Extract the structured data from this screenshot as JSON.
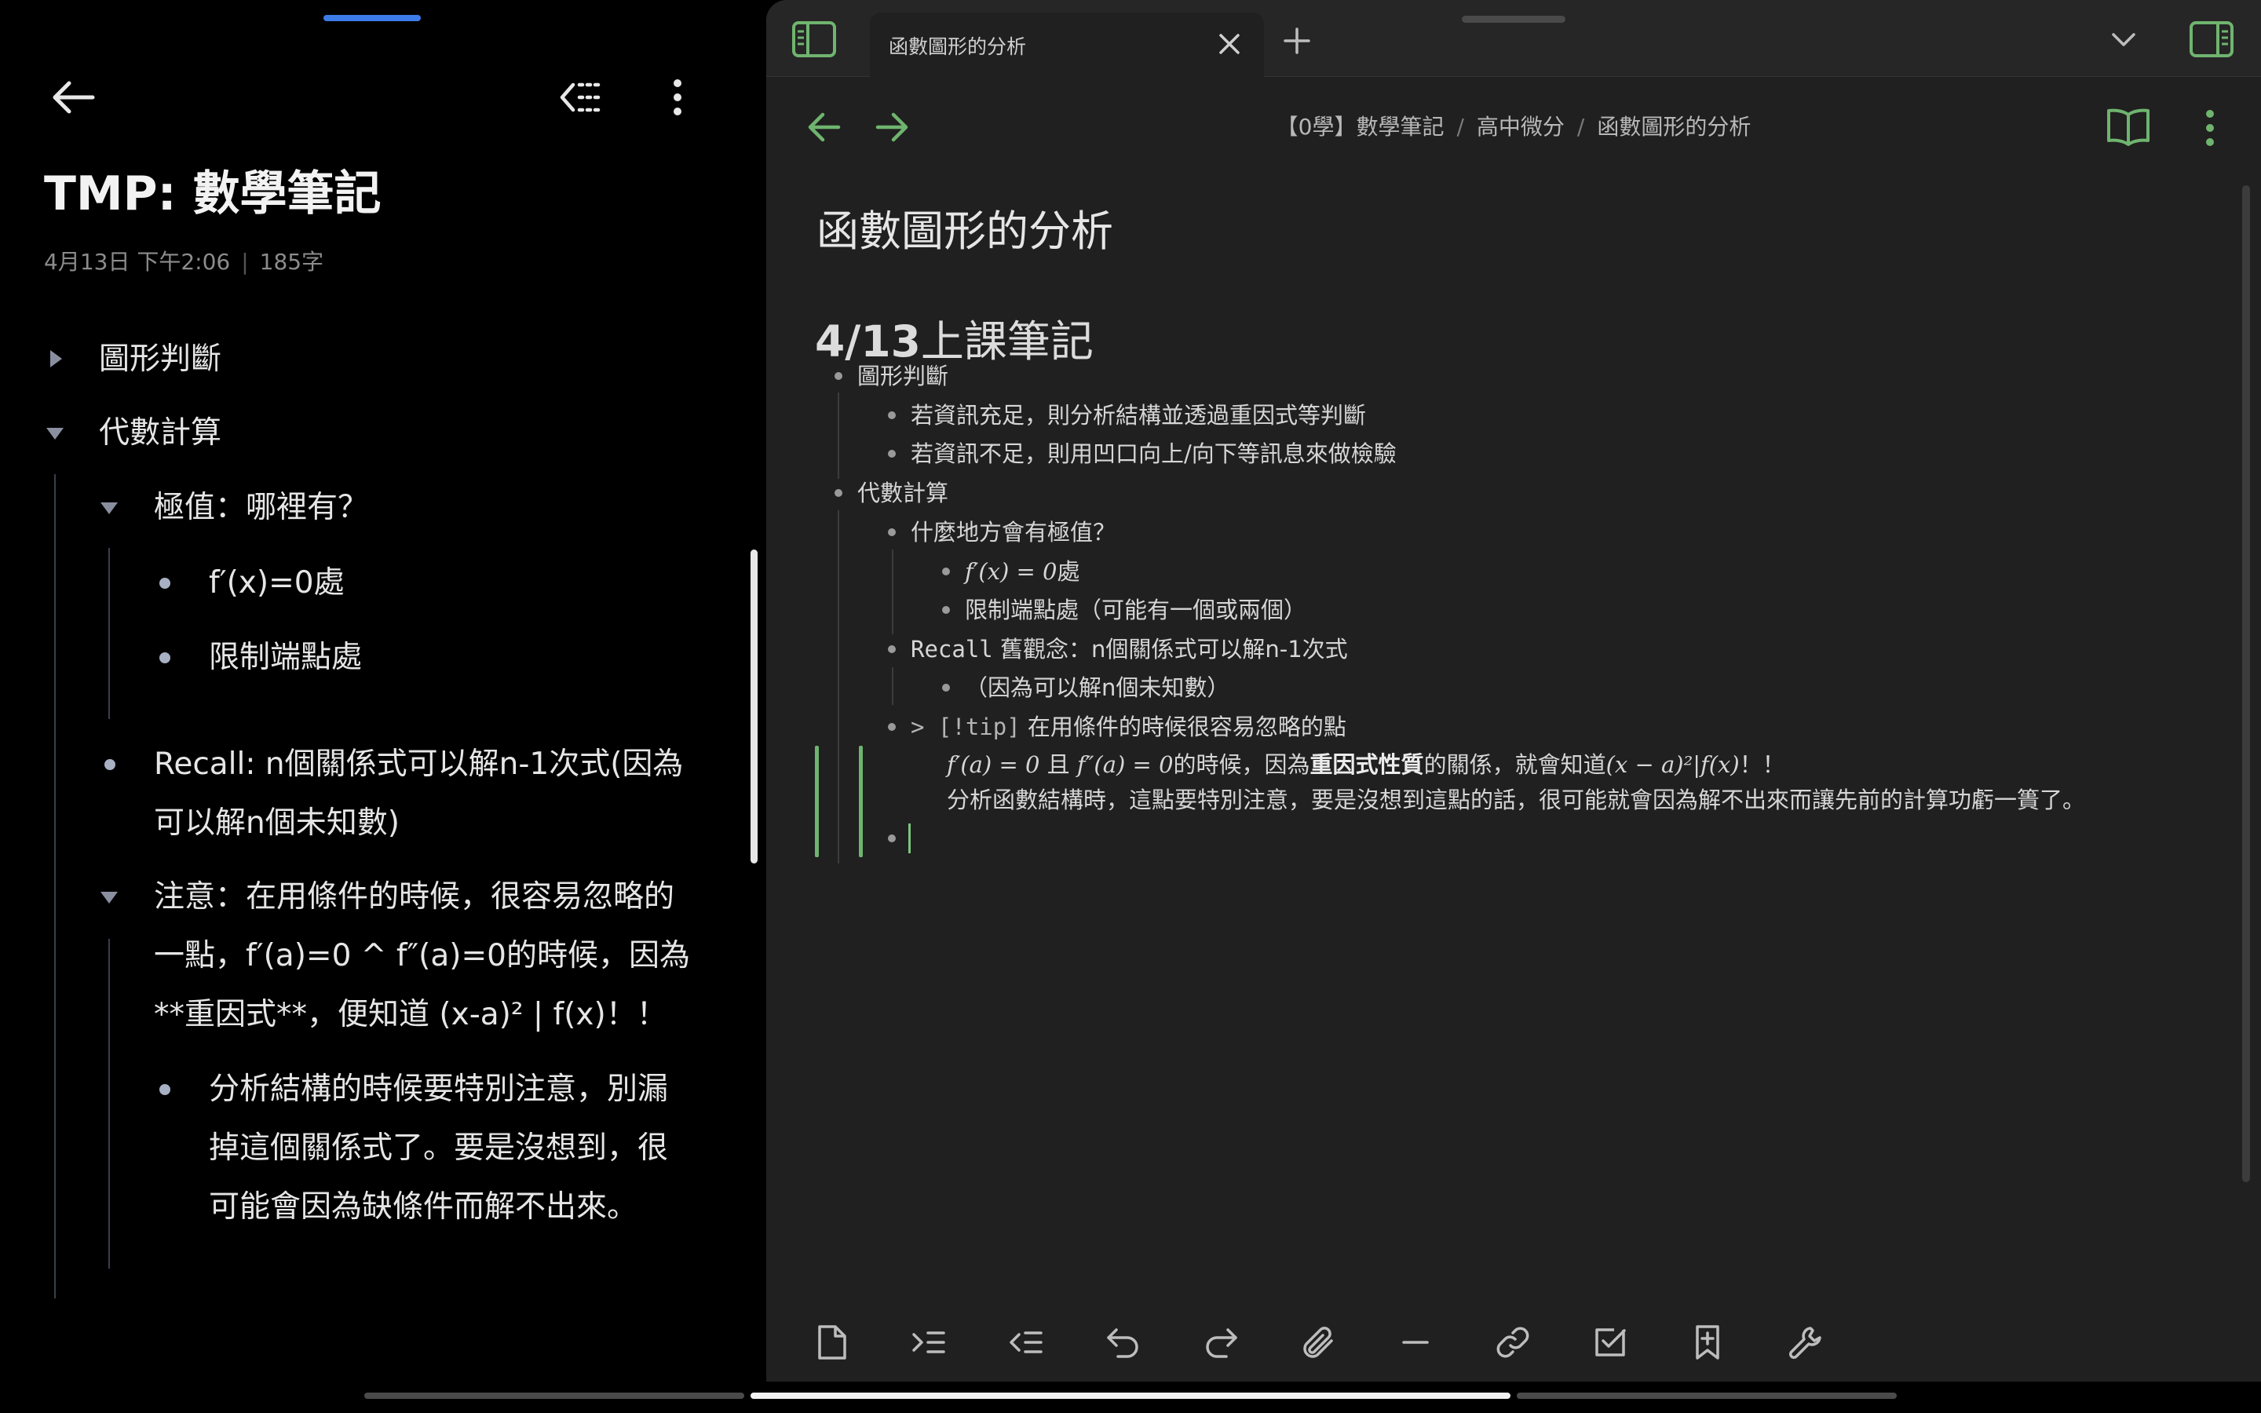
{
  "left": {
    "title": "TMP: 數學筆記",
    "meta_date": "4月13日 下午2:06",
    "meta_separator": "|",
    "meta_count": "185字",
    "items": {
      "graph": "圖形判斷",
      "algebra": "代數計算",
      "extrema": "極值：哪裡有？",
      "fprime": "f′(x)=0處",
      "endpoint": "限制端點處",
      "recall": "Recall: n個關係式可以解n-1次式(因為可以解n個未知數)",
      "note": "注意：在用條件的時候，很容易忽略的一點，f′(a)=0 ^ f″(a)=0的時候，因為**重因式**，便知道 (x-a)² | f(x)！！",
      "analysis": "分析結構的時候要特別注意，別漏掉這個關係式了。要是沒想到，很可能會因為缺條件而解不出來。"
    }
  },
  "right": {
    "tab_title": "函數圖形的分析",
    "breadcrumb": {
      "part1": "【0學】數學筆記",
      "part2": "高中微分",
      "part3": "函數圖形的分析",
      "sep": "/"
    },
    "doc_title": "函數圖形的分析",
    "heading_num": "4/13",
    "heading_text": "上課筆記",
    "lines": {
      "graph": "圖形判斷",
      "graph_a": "若資訊充足，則分析結構並透過重因式等判斷",
      "graph_b": "若資訊不足，則用凹口向上/向下等訊息來做檢驗",
      "algebra": "代數計算",
      "extrema": "什麼地方會有極值？",
      "fprime_math": "f′(x) = 0",
      "fprime_suffix": "處",
      "endpoint": "限制端點處（可能有一個或兩個）",
      "recall_prefix": "Recall",
      "recall_rest": " 舊觀念：n個關係式可以解n-1次式",
      "recall_sub": "（因為可以解n個未知數）",
      "tip_marker": "> [!tip]",
      "tip_text": " 在用條件的時候很容易忽略的點",
      "tip_l1_math1": "f′(a) = 0",
      "tip_l1_and": " 且 ",
      "tip_l1_math2": "f″(a) = 0",
      "tip_l1_mid": "的時候，因為",
      "tip_l1_bold": "重因式性質",
      "tip_l1_mid2": "的關係，就會知道",
      "tip_l1_math3": "(x − a)²|f(x)",
      "tip_l1_end": "！！",
      "tip_l2": "分析函數結構時，這點要特別注意，要是沒想到這點的話，很可能就會因為解不出來而讓先前的計算功虧一簣了。"
    }
  },
  "colors": {
    "accent_green": "#6fb46f",
    "handle_blue": "#3d7be8",
    "editor_bg": "#202020"
  },
  "icons": {
    "left": [
      "back-arrow-icon",
      "outdent-icon",
      "more-vertical-icon"
    ],
    "right_tabbar": [
      "sidebar-left-icon",
      "close-icon",
      "plus-icon",
      "chevron-down-icon",
      "sidebar-right-icon"
    ],
    "right_nav": [
      "back-arrow-icon",
      "forward-arrow-icon",
      "book-open-icon",
      "more-vertical-icon"
    ],
    "toolbar": [
      "file-icon",
      "indent-icon",
      "outdent-icon",
      "undo-icon",
      "redo-icon",
      "paperclip-icon",
      "minus-icon",
      "link-icon",
      "checkbox-icon",
      "bookmark-plus-icon",
      "wrench-icon"
    ]
  }
}
